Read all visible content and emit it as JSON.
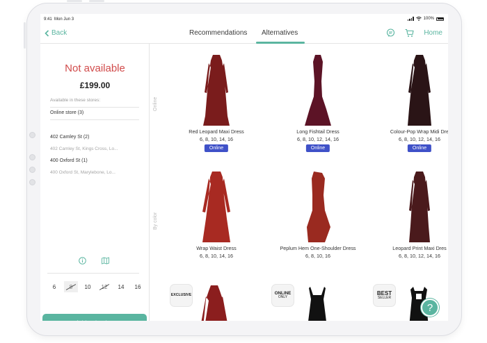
{
  "status": {
    "time": "9:41",
    "date": "Mon Jun 3",
    "battery": "100%"
  },
  "nav": {
    "back_label": "Back",
    "tabs": [
      {
        "label": "Recommendations",
        "active": false
      },
      {
        "label": "Alternatives",
        "active": true
      }
    ],
    "home_label": "Home",
    "icons": [
      "chat-icon",
      "cart-icon"
    ]
  },
  "product": {
    "availability": "Not available",
    "price": "£199.00",
    "stores_label": "Available in these stores:",
    "stores": [
      {
        "name": "Online store (3)",
        "address": ""
      },
      {
        "name": "402 Camley St (2)",
        "address": "402 Camley St, Kings Cross, Lo..."
      },
      {
        "name": "400 Oxford St (1)",
        "address": "400 Oxford St, Marylebone, Lo..."
      }
    ],
    "sizes": [
      {
        "label": "6",
        "available": true,
        "selected": false
      },
      {
        "label": "8",
        "available": false,
        "selected": true
      },
      {
        "label": "10",
        "available": true,
        "selected": false
      },
      {
        "label": "12",
        "available": false,
        "selected": false
      },
      {
        "label": "14",
        "available": true,
        "selected": false
      },
      {
        "label": "16",
        "available": true,
        "selected": false
      }
    ],
    "basket_label": "Add to basket",
    "panel_icons": [
      "info-icon",
      "map-icon"
    ]
  },
  "sections": [
    {
      "label": "Online",
      "items": [
        {
          "name": "Red Leopard Maxi Dress",
          "sizes": "6, 8, 10, 14, 16",
          "badge": "Online",
          "color": "#7a1c1c"
        },
        {
          "name": "Long Fishtail Dress",
          "sizes": "6, 8, 10, 12, 14, 16",
          "badge": "Online",
          "color": "#5c1326"
        },
        {
          "name": "Colour-Pop Wrap Midi Dre",
          "sizes": "6, 8, 10, 12, 14, 16",
          "badge": "Online",
          "color": "#2a1416"
        }
      ]
    },
    {
      "label": "By color",
      "items": [
        {
          "name": "Wrap Waist  Dress",
          "sizes": "6, 8, 10, 14, 16",
          "badge": "",
          "color": "#a82a22"
        },
        {
          "name": "Peplum Hem One-Shoulder Dress",
          "sizes": "6, 8, 10, 16",
          "badge": "",
          "color": "#9a2a20"
        },
        {
          "name": "Leopard Print Maxi Dres",
          "sizes": "6, 8, 10, 12, 14, 16",
          "badge": "",
          "color": "#4a1a1c"
        }
      ]
    }
  ],
  "tags": [
    {
      "line1": "EXCLUSIVE",
      "line2": ""
    },
    {
      "line1": "ONLINE",
      "line2": "ONLY"
    },
    {
      "line1": "BEST",
      "line2": "SELLER"
    }
  ],
  "bottom_dresses": [
    "#8b1e1e",
    "#111111",
    "#111111"
  ],
  "help_label": "?",
  "colors": {
    "accent": "#5ab5a0",
    "unavailable": "#d14b4b",
    "badge": "#3f51c8"
  }
}
